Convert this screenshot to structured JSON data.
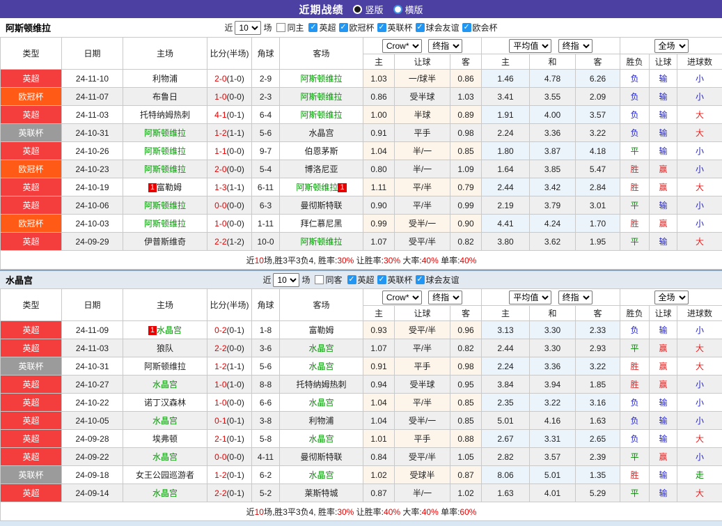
{
  "title_bar": {
    "title": "近期战绩",
    "radios": [
      {
        "label": "竖版",
        "selected": true
      },
      {
        "label": "横版",
        "selected": false
      }
    ]
  },
  "colors": {
    "accent_purple": "#4c41a3",
    "check_blue": "#2196f3",
    "team_green": "#009900",
    "score_red": "#e80000",
    "win_red": "#e52222",
    "loss_blue": "#2222cc",
    "draw_green": "#008800",
    "league": {
      "英超": "#f43e3e",
      "欧冠杯": "#ff5b17",
      "英联杯": "#9b9b9b"
    }
  },
  "filter_words": {
    "near": "近",
    "matches": "场"
  },
  "columns": {
    "type": "类型",
    "date": "日期",
    "home": "主场",
    "score": "比分(半场)",
    "corner": "角球",
    "away": "客场",
    "odds_selects": [
      "Crow*",
      "终指"
    ],
    "avg_selects": [
      "平均值",
      "终指"
    ],
    "scope_select": "全场",
    "odds_sub": [
      "主",
      "让球",
      "客"
    ],
    "avg_sub": [
      "主",
      "和",
      "客"
    ],
    "result_sub": [
      "胜负",
      "让球",
      "进球数"
    ]
  },
  "tables": [
    {
      "team": "阿斯顿维拉",
      "filter": {
        "count": "10",
        "same": {
          "label": "同主",
          "checked": false
        },
        "leagues": [
          {
            "label": "英超",
            "checked": true
          },
          {
            "label": "欧冠杯",
            "checked": true
          },
          {
            "label": "英联杯",
            "checked": true
          },
          {
            "label": "球会友谊",
            "checked": true
          },
          {
            "label": "欧会杯",
            "checked": true
          }
        ]
      },
      "rows": [
        {
          "league": "英超",
          "date": "24-11-10",
          "home": {
            "name": "利物浦",
            "green": false,
            "badge": ""
          },
          "score_ft": "2-0",
          "score_ht": "(1-0)",
          "corner": "2-9",
          "away": {
            "name": "阿斯顿维拉",
            "green": true,
            "badge": ""
          },
          "odds": [
            "1.03",
            "一/球半",
            "0.86"
          ],
          "avg": [
            "1.46",
            "4.78",
            "6.26"
          ],
          "result": [
            "负",
            "输",
            "小"
          ]
        },
        {
          "league": "欧冠杯",
          "date": "24-11-07",
          "home": {
            "name": "布鲁日",
            "green": false,
            "badge": ""
          },
          "score_ft": "1-0",
          "score_ht": "(0-0)",
          "corner": "2-3",
          "away": {
            "name": "阿斯顿维拉",
            "green": true,
            "badge": ""
          },
          "odds": [
            "0.86",
            "受半球",
            "1.03"
          ],
          "avg": [
            "3.41",
            "3.55",
            "2.09"
          ],
          "result": [
            "负",
            "输",
            "小"
          ]
        },
        {
          "league": "英超",
          "date": "24-11-03",
          "home": {
            "name": "托特纳姆热刺",
            "green": false,
            "badge": ""
          },
          "score_ft": "4-1",
          "score_ht": "(0-1)",
          "corner": "6-4",
          "away": {
            "name": "阿斯顿维拉",
            "green": true,
            "badge": ""
          },
          "odds": [
            "1.00",
            "半球",
            "0.89"
          ],
          "avg": [
            "1.91",
            "4.00",
            "3.57"
          ],
          "result": [
            "负",
            "输",
            "大"
          ]
        },
        {
          "league": "英联杯",
          "date": "24-10-31",
          "home": {
            "name": "阿斯顿维拉",
            "green": true,
            "badge": ""
          },
          "score_ft": "1-2",
          "score_ht": "(1-1)",
          "corner": "5-6",
          "away": {
            "name": "水晶宫",
            "green": false,
            "badge": ""
          },
          "odds": [
            "0.91",
            "平手",
            "0.98"
          ],
          "avg": [
            "2.24",
            "3.36",
            "3.22"
          ],
          "result": [
            "负",
            "输",
            "大"
          ]
        },
        {
          "league": "英超",
          "date": "24-10-26",
          "home": {
            "name": "阿斯顿维拉",
            "green": true,
            "badge": ""
          },
          "score_ft": "1-1",
          "score_ht": "(0-0)",
          "corner": "9-7",
          "away": {
            "name": "伯恩茅斯",
            "green": false,
            "badge": ""
          },
          "odds": [
            "1.04",
            "半/一",
            "0.85"
          ],
          "avg": [
            "1.80",
            "3.87",
            "4.18"
          ],
          "result": [
            "平",
            "输",
            "小"
          ]
        },
        {
          "league": "欧冠杯",
          "date": "24-10-23",
          "home": {
            "name": "阿斯顿维拉",
            "green": true,
            "badge": ""
          },
          "score_ft": "2-0",
          "score_ht": "(0-0)",
          "corner": "5-4",
          "away": {
            "name": "博洛尼亚",
            "green": false,
            "badge": ""
          },
          "odds": [
            "0.80",
            "半/一",
            "1.09"
          ],
          "avg": [
            "1.64",
            "3.85",
            "5.47"
          ],
          "result": [
            "胜",
            "赢",
            "小"
          ]
        },
        {
          "league": "英超",
          "date": "24-10-19",
          "home": {
            "name": "富勒姆",
            "green": false,
            "badge": "1"
          },
          "score_ft": "1-3",
          "score_ht": "(1-1)",
          "corner": "6-11",
          "away": {
            "name": "阿斯顿维拉",
            "green": true,
            "badge": "1"
          },
          "odds": [
            "1.11",
            "平/半",
            "0.79"
          ],
          "avg": [
            "2.44",
            "3.42",
            "2.84"
          ],
          "result": [
            "胜",
            "赢",
            "大"
          ]
        },
        {
          "league": "英超",
          "date": "24-10-06",
          "home": {
            "name": "阿斯顿维拉",
            "green": true,
            "badge": ""
          },
          "score_ft": "0-0",
          "score_ht": "(0-0)",
          "corner": "6-3",
          "away": {
            "name": "曼彻斯特联",
            "green": false,
            "badge": ""
          },
          "odds": [
            "0.90",
            "平/半",
            "0.99"
          ],
          "avg": [
            "2.19",
            "3.79",
            "3.01"
          ],
          "result": [
            "平",
            "输",
            "小"
          ]
        },
        {
          "league": "欧冠杯",
          "date": "24-10-03",
          "home": {
            "name": "阿斯顿维拉",
            "green": true,
            "badge": ""
          },
          "score_ft": "1-0",
          "score_ht": "(0-0)",
          "corner": "1-11",
          "away": {
            "name": "拜仁慕尼黑",
            "green": false,
            "badge": ""
          },
          "odds": [
            "0.99",
            "受半/一",
            "0.90"
          ],
          "avg": [
            "4.41",
            "4.24",
            "1.70"
          ],
          "result": [
            "胜",
            "赢",
            "小"
          ]
        },
        {
          "league": "英超",
          "date": "24-09-29",
          "home": {
            "name": "伊普斯维奇",
            "green": false,
            "badge": ""
          },
          "score_ft": "2-2",
          "score_ht": "(1-2)",
          "corner": "10-0",
          "away": {
            "name": "阿斯顿维拉",
            "green": true,
            "badge": ""
          },
          "odds": [
            "1.07",
            "受平/半",
            "0.82"
          ],
          "avg": [
            "3.80",
            "3.62",
            "1.95"
          ],
          "result": [
            "平",
            "输",
            "大"
          ]
        }
      ],
      "summary": [
        {
          "t": "近",
          "red": false
        },
        {
          "t": "10",
          "red": true
        },
        {
          "t": "场,胜3平3负4, 胜率:",
          "red": false
        },
        {
          "t": "30%",
          "red": true
        },
        {
          "t": " 让胜率:",
          "red": false
        },
        {
          "t": "30%",
          "red": true
        },
        {
          "t": " 大率:",
          "red": false
        },
        {
          "t": "40%",
          "red": true
        },
        {
          "t": " 单率:",
          "red": false
        },
        {
          "t": "40%",
          "red": true
        }
      ]
    },
    {
      "team": "水晶宫",
      "filter": {
        "count": "10",
        "same": {
          "label": "同客",
          "checked": false
        },
        "leagues": [
          {
            "label": "英超",
            "checked": true
          },
          {
            "label": "英联杯",
            "checked": true
          },
          {
            "label": "球会友谊",
            "checked": true
          }
        ]
      },
      "rows": [
        {
          "league": "英超",
          "date": "24-11-09",
          "home": {
            "name": "水晶宫",
            "green": true,
            "badge": "1"
          },
          "score_ft": "0-2",
          "score_ht": "(0-1)",
          "corner": "1-8",
          "away": {
            "name": "富勒姆",
            "green": false,
            "badge": ""
          },
          "odds": [
            "0.93",
            "受平/半",
            "0.96"
          ],
          "avg": [
            "3.13",
            "3.30",
            "2.33"
          ],
          "result": [
            "负",
            "输",
            "小"
          ]
        },
        {
          "league": "英超",
          "date": "24-11-03",
          "home": {
            "name": "狼队",
            "green": false,
            "badge": ""
          },
          "score_ft": "2-2",
          "score_ht": "(0-0)",
          "corner": "3-6",
          "away": {
            "name": "水晶宫",
            "green": true,
            "badge": ""
          },
          "odds": [
            "1.07",
            "平/半",
            "0.82"
          ],
          "avg": [
            "2.44",
            "3.30",
            "2.93"
          ],
          "result": [
            "平",
            "赢",
            "大"
          ]
        },
        {
          "league": "英联杯",
          "date": "24-10-31",
          "home": {
            "name": "阿斯顿维拉",
            "green": false,
            "badge": ""
          },
          "score_ft": "1-2",
          "score_ht": "(1-1)",
          "corner": "5-6",
          "away": {
            "name": "水晶宫",
            "green": true,
            "badge": ""
          },
          "odds": [
            "0.91",
            "平手",
            "0.98"
          ],
          "avg": [
            "2.24",
            "3.36",
            "3.22"
          ],
          "result": [
            "胜",
            "赢",
            "大"
          ]
        },
        {
          "league": "英超",
          "date": "24-10-27",
          "home": {
            "name": "水晶宫",
            "green": true,
            "badge": ""
          },
          "score_ft": "1-0",
          "score_ht": "(1-0)",
          "corner": "8-8",
          "away": {
            "name": "托特纳姆热刺",
            "green": false,
            "badge": ""
          },
          "odds": [
            "0.94",
            "受半球",
            "0.95"
          ],
          "avg": [
            "3.84",
            "3.94",
            "1.85"
          ],
          "result": [
            "胜",
            "赢",
            "小"
          ]
        },
        {
          "league": "英超",
          "date": "24-10-22",
          "home": {
            "name": "诺丁汉森林",
            "green": false,
            "badge": ""
          },
          "score_ft": "1-0",
          "score_ht": "(0-0)",
          "corner": "6-6",
          "away": {
            "name": "水晶宫",
            "green": true,
            "badge": ""
          },
          "odds": [
            "1.04",
            "平/半",
            "0.85"
          ],
          "avg": [
            "2.35",
            "3.22",
            "3.16"
          ],
          "result": [
            "负",
            "输",
            "小"
          ]
        },
        {
          "league": "英超",
          "date": "24-10-05",
          "home": {
            "name": "水晶宫",
            "green": true,
            "badge": ""
          },
          "score_ft": "0-1",
          "score_ht": "(0-1)",
          "corner": "3-8",
          "away": {
            "name": "利物浦",
            "green": false,
            "badge": ""
          },
          "odds": [
            "1.04",
            "受半/一",
            "0.85"
          ],
          "avg": [
            "5.01",
            "4.16",
            "1.63"
          ],
          "result": [
            "负",
            "输",
            "小"
          ]
        },
        {
          "league": "英超",
          "date": "24-09-28",
          "home": {
            "name": "埃弗顿",
            "green": false,
            "badge": ""
          },
          "score_ft": "2-1",
          "score_ht": "(0-1)",
          "corner": "5-8",
          "away": {
            "name": "水晶宫",
            "green": true,
            "badge": ""
          },
          "odds": [
            "1.01",
            "平手",
            "0.88"
          ],
          "avg": [
            "2.67",
            "3.31",
            "2.65"
          ],
          "result": [
            "负",
            "输",
            "大"
          ]
        },
        {
          "league": "英超",
          "date": "24-09-22",
          "home": {
            "name": "水晶宫",
            "green": true,
            "badge": ""
          },
          "score_ft": "0-0",
          "score_ht": "(0-0)",
          "corner": "4-11",
          "away": {
            "name": "曼彻斯特联",
            "green": false,
            "badge": ""
          },
          "odds": [
            "0.84",
            "受平/半",
            "1.05"
          ],
          "avg": [
            "2.82",
            "3.57",
            "2.39"
          ],
          "result": [
            "平",
            "赢",
            "小"
          ]
        },
        {
          "league": "英联杯",
          "date": "24-09-18",
          "home": {
            "name": "女王公园巡游者",
            "green": false,
            "badge": ""
          },
          "score_ft": "1-2",
          "score_ht": "(0-1)",
          "corner": "6-2",
          "away": {
            "name": "水晶宫",
            "green": true,
            "badge": ""
          },
          "odds": [
            "1.02",
            "受球半",
            "0.87"
          ],
          "avg": [
            "8.06",
            "5.01",
            "1.35"
          ],
          "result": [
            "胜",
            "输",
            "走"
          ]
        },
        {
          "league": "英超",
          "date": "24-09-14",
          "home": {
            "name": "水晶宫",
            "green": true,
            "badge": ""
          },
          "score_ft": "2-2",
          "score_ht": "(0-1)",
          "corner": "5-2",
          "away": {
            "name": "莱斯特城",
            "green": false,
            "badge": ""
          },
          "odds": [
            "0.87",
            "半/一",
            "1.02"
          ],
          "avg": [
            "1.63",
            "4.01",
            "5.29"
          ],
          "result": [
            "平",
            "输",
            "大"
          ]
        }
      ],
      "summary": [
        {
          "t": "近",
          "red": false
        },
        {
          "t": "10",
          "red": true
        },
        {
          "t": "场,胜3平3负4, 胜率:",
          "red": false
        },
        {
          "t": "30%",
          "red": true
        },
        {
          "t": " 让胜率:",
          "red": false
        },
        {
          "t": "40%",
          "red": true
        },
        {
          "t": " 大率:",
          "red": false
        },
        {
          "t": "40%",
          "red": true
        },
        {
          "t": " 单率:",
          "red": false
        },
        {
          "t": "60%",
          "red": true
        }
      ]
    }
  ]
}
